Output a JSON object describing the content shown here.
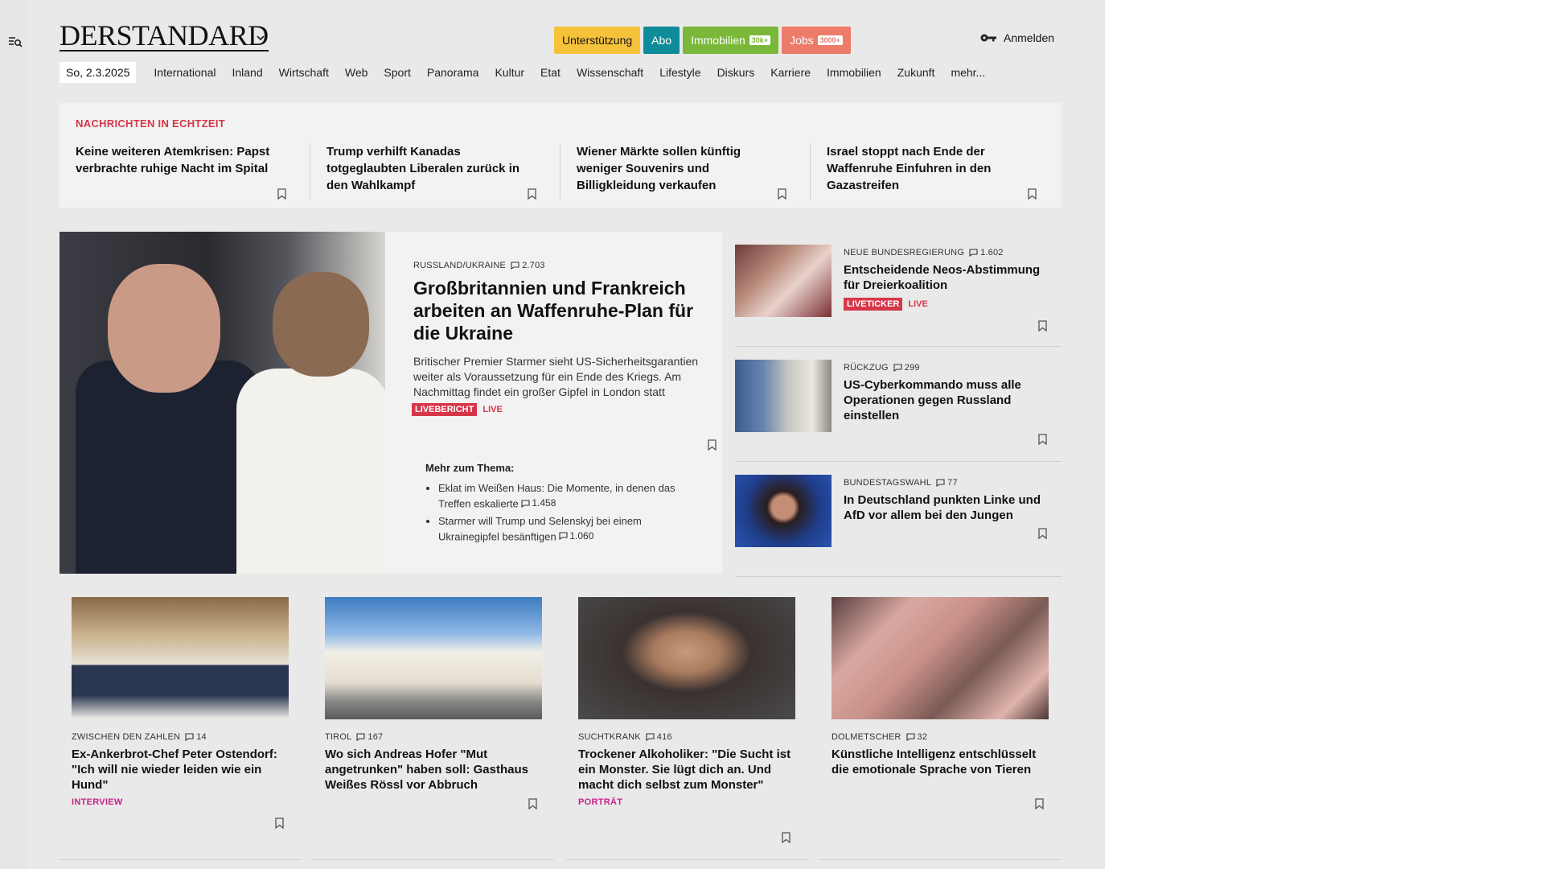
{
  "logo": "DERSTANDARD",
  "header": {
    "buttons": {
      "support": "Unterstützung",
      "abo": "Abo",
      "immobilien": "Immobilien",
      "immobilien_badge": "30k+",
      "jobs": "Jobs",
      "jobs_badge": "3000+"
    },
    "login": "Anmelden"
  },
  "nav": {
    "date": "So, 2.3.2025",
    "items": [
      "International",
      "Inland",
      "Wirtschaft",
      "Web",
      "Sport",
      "Panorama",
      "Kultur",
      "Etat",
      "Wissenschaft",
      "Lifestyle",
      "Diskurs",
      "Karriere",
      "Immobilien",
      "Zukunft",
      "mehr..."
    ]
  },
  "ticker": {
    "title": "NACHRICHTEN IN ECHTZEIT",
    "items": [
      "Keine weiteren Atemkrisen: Papst verbrachte ruhige Nacht im Spital",
      "Trump verhilft Kanadas totgeglaubten Liberalen zurück in den Wahlkampf",
      "Wiener Märkte sollen künftig weniger Souvenirs und Billigkleidung verkaufen",
      "Israel stoppt nach Ende der Waffenruhe Einfuhren in den Gazastreifen"
    ]
  },
  "lead": {
    "kicker": "RUSSLAND/UKRAINE",
    "comments": "2.703",
    "title": "Großbritannien und Frankreich arbeiten an Waffenruhe-Plan für die Ukraine",
    "subtitle": "Britischer Premier Starmer sieht US-Sicherheitsgarantien weiter als Voraussetzung für ein Ende des Kriegs. Am Nachmittag findet ein großer Gipfel in London statt",
    "tag": "LIVEBERICHT",
    "live": "LIVE",
    "more_title": "Mehr zum Thema:",
    "more_items": [
      {
        "text": "Eklat im Weißen Haus: Die Momente, in denen das Treffen eskalierte",
        "comments": "1.458"
      },
      {
        "text": "Starmer will Trump und Selenskyj bei einem Ukrainegipfel besänftigen",
        "comments": "1.060"
      }
    ]
  },
  "side": [
    {
      "kicker": "NEUE BUNDESREGIERUNG",
      "comments": "1.602",
      "title": "Entscheidende Neos-Abstimmung für Dreierkoalition",
      "tag": "LIVETICKER",
      "live": "LIVE"
    },
    {
      "kicker": "RÜCKZUG",
      "comments": "299",
      "title": "US-Cyberkommando muss alle Operationen gegen Russland einstellen"
    },
    {
      "kicker": "BUNDESTAGSWAHL",
      "comments": "77",
      "title": "In Deutschland punkten Linke und AfD vor allem bei den Jungen"
    }
  ],
  "cards": [
    {
      "kicker": "ZWISCHEN DEN ZAHLEN",
      "comments": "14",
      "title": "Ex-Ankerbrot-Chef Peter Ostendorf: \"Ich will nie wieder leiden wie ein Hund\"",
      "tag": "INTERVIEW"
    },
    {
      "kicker": "TIROL",
      "comments": "167",
      "title": "Wo sich Andreas Hofer \"Mut angetrunken\" haben soll: Gasthaus Weißes Rössl vor Abbruch"
    },
    {
      "kicker": "SUCHTKRANK",
      "comments": "416",
      "title": "Trockener Alkoholiker: \"Die Sucht ist ein Monster. Sie lügt dich an. Und macht dich selbst zum Monster\"",
      "tag": "PORTRÄT"
    },
    {
      "kicker": "DOLMETSCHER",
      "comments": "32",
      "title": "Künstliche Intelligenz entschlüsselt die emotionale Sprache von Tieren"
    }
  ],
  "colors": {
    "accent_red": "#d63649",
    "tag_pink": "#c8218a",
    "support": "#f5c23a",
    "abo": "#0f8c99",
    "immobilien": "#7bb83a",
    "jobs": "#ee7b6a"
  }
}
